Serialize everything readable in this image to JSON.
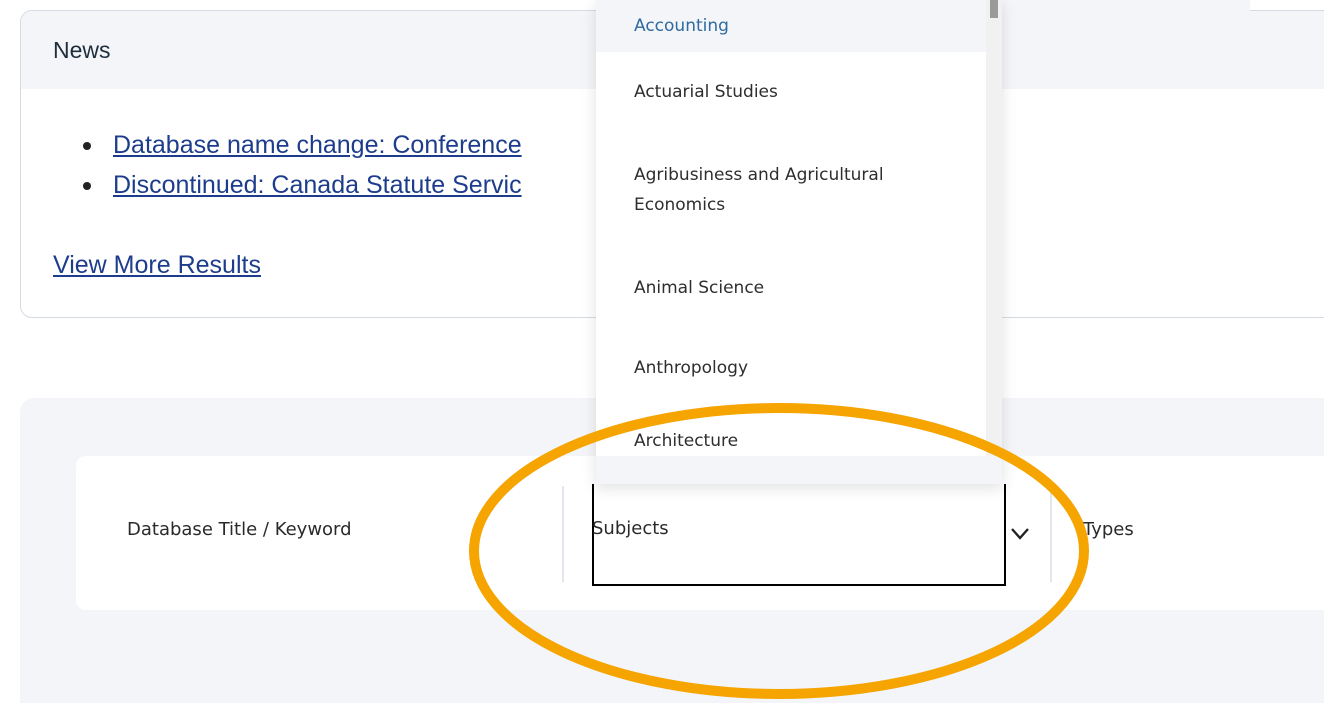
{
  "news": {
    "title": "News",
    "items": [
      {
        "label": "Database name change: Conference"
      },
      {
        "label": "Discontinued: Canada Statute Servic"
      }
    ],
    "view_more": "View More Results"
  },
  "search": {
    "keyword_label": "Database Title / Keyword",
    "subjects_label": "Subjects",
    "types_label": "Types"
  },
  "dropdown": {
    "options": [
      "Accounting",
      "Actuarial Studies",
      "Agribusiness and Agricultural Economics",
      "Animal Science",
      "Anthropology",
      "Architecture"
    ],
    "selected": "Accounting"
  },
  "colors": {
    "link": "#1d3d8c",
    "panel_bg": "#f3f5f8",
    "highlight": "#2f6aa0",
    "annotation": "#f5a400"
  },
  "icons": {
    "subjects_toggle": "chevron-down-icon"
  }
}
